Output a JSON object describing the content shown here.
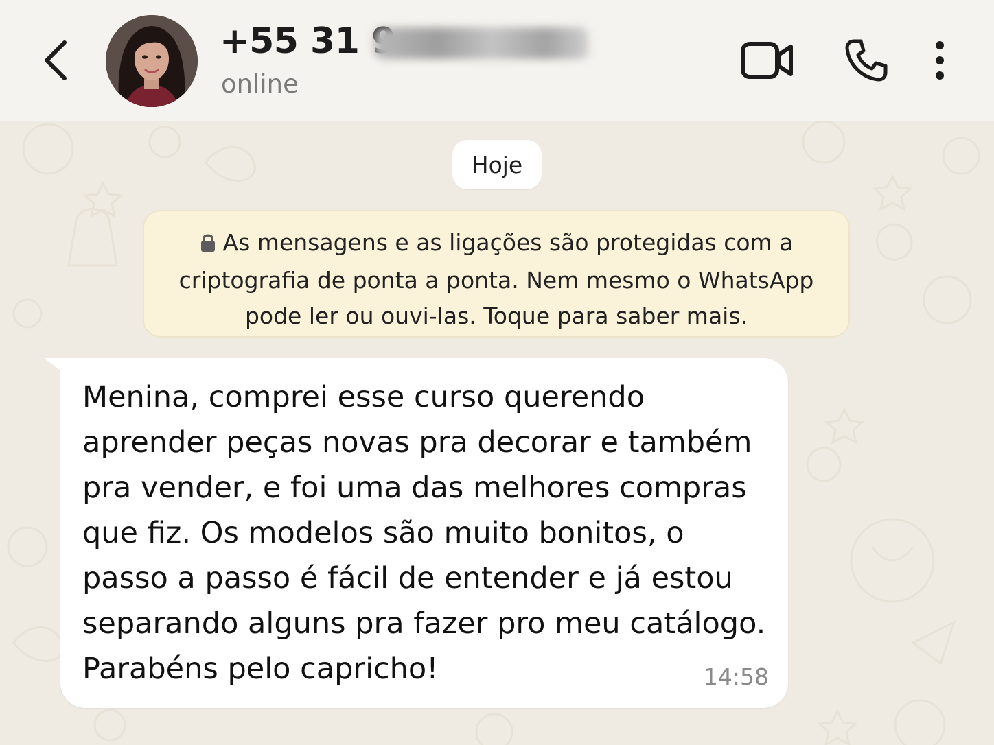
{
  "header": {
    "contact_name": "+55 31 9",
    "status": "online",
    "back_icon": "chevron-left-icon",
    "video_icon": "video-camera-icon",
    "call_icon": "phone-icon",
    "menu_icon": "more-vertical-icon"
  },
  "chat": {
    "date_label": "Hoje",
    "encryption_notice": "As mensagens e as ligações são protegidas com a criptografia de ponta a ponta. Nem mesmo o WhatsApp pode ler ou ouvi-las. Toque para saber mais.",
    "message": {
      "text": "Menina, comprei esse curso querendo aprender peças novas pra decorar e também pra vender, e foi uma das melhores compras que fiz. Os modelos são muito bonitos, o passo a passo é fácil de entender e já estou separando alguns pra fazer pro meu catálogo. Parabéns pelo capricho!",
      "time": "14:58"
    }
  },
  "colors": {
    "header_bg": "#f5f3ef",
    "chat_bg": "#f0ebe2",
    "notice_bg": "#fbf2da",
    "bubble_bg": "#ffffff"
  }
}
